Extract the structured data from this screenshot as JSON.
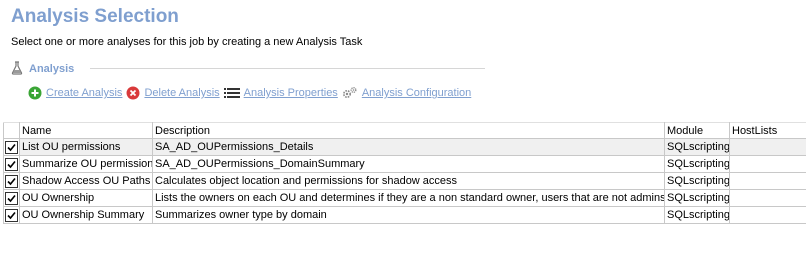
{
  "header": {
    "title": "Analysis Selection",
    "subtitle": "Select one or more analyses for this job by creating a new Analysis Task"
  },
  "section": {
    "label": "Analysis",
    "icon": "flask-icon"
  },
  "toolbar": {
    "create_label": "Create Analysis",
    "delete_label": "Delete Analysis",
    "properties_label": "Analysis Properties",
    "configuration_label": "Analysis Configuration"
  },
  "colors": {
    "title": "#7f9fcf",
    "link": "#7f9fcf",
    "create_icon": "#3aa535",
    "delete_icon": "#d9393a"
  },
  "table": {
    "columns": [
      "Name",
      "Description",
      "Module",
      "HostLists"
    ],
    "rows": [
      {
        "checked": true,
        "name": "List OU permissions",
        "description": "SA_AD_OUPermissions_Details",
        "module": "SQLscripting",
        "hostlists": ""
      },
      {
        "checked": true,
        "name": "Summarize OU permissions",
        "description": "SA_AD_OUPermissions_DomainSummary",
        "module": "SQLscripting",
        "hostlists": ""
      },
      {
        "checked": true,
        "name": "Shadow Access OU Paths",
        "description": "Calculates object location and permissions for shadow access",
        "module": "SQLscripting",
        "hostlists": ""
      },
      {
        "checked": true,
        "name": "OU Ownership",
        "description": "Lists the owners on each OU and determines if they are a non standard owner, users that are not admins",
        "module": "SQLscripting",
        "hostlists": ""
      },
      {
        "checked": true,
        "name": "OU Ownership Summary",
        "description": "Summarizes owner type by domain",
        "module": "SQLscripting",
        "hostlists": ""
      }
    ]
  }
}
